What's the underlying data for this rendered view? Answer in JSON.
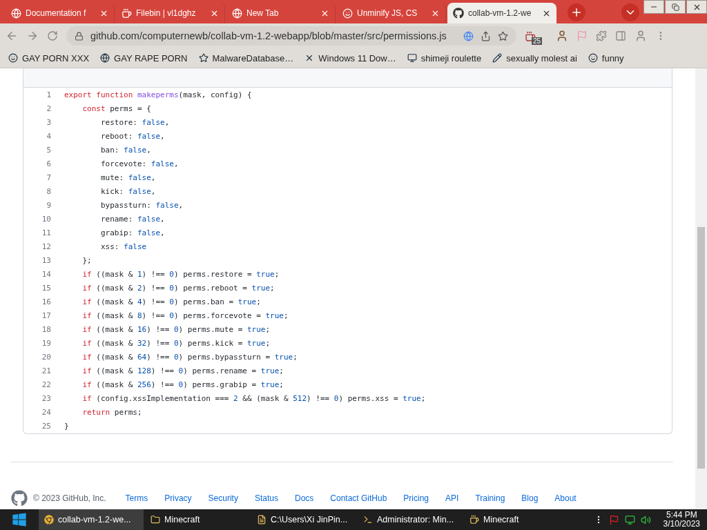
{
  "browser": {
    "tabs": [
      {
        "title": "Documentation f",
        "selected": false
      },
      {
        "title": "Filebin | vl1dghz",
        "selected": false
      },
      {
        "title": "New Tab",
        "selected": false
      },
      {
        "title": "Unminify JS, CS",
        "selected": false
      },
      {
        "title": "collab-vm-1.2-we",
        "selected": true
      }
    ],
    "address": "github.com/computernewb/collab-vm-1.2-webapp/blob/master/src/permissions.js",
    "extension_badge": "25",
    "bookmarks": [
      {
        "label": "GAY PORN XXX"
      },
      {
        "label": "GAY RAPE PORN"
      },
      {
        "label": "MalwareDatabase…"
      },
      {
        "label": "Windows 11 Dow…"
      },
      {
        "label": "shimeji roulette"
      },
      {
        "label": "sexually molest ai"
      },
      {
        "label": "funny"
      }
    ]
  },
  "code": {
    "lines": [
      {
        "number": "1",
        "tokens": [
          {
            "kind": "keyword",
            "text": "export function"
          },
          {
            "kind": "entity",
            "text": " makeperms"
          },
          {
            "kind": "plain",
            "text": "(mask, config) {"
          }
        ]
      },
      {
        "number": "2",
        "tokens": [
          {
            "kind": "keyword",
            "text": "    const"
          },
          {
            "kind": "plain",
            "text": " perms = {"
          }
        ]
      },
      {
        "number": "3",
        "tokens": [
          {
            "kind": "plain",
            "text": "        restore: "
          },
          {
            "kind": "constant",
            "text": "false"
          },
          {
            "kind": "plain",
            "text": ","
          }
        ]
      },
      {
        "number": "4",
        "tokens": [
          {
            "kind": "plain",
            "text": "        reboot: "
          },
          {
            "kind": "constant",
            "text": "false"
          },
          {
            "kind": "plain",
            "text": ","
          }
        ]
      },
      {
        "number": "5",
        "tokens": [
          {
            "kind": "plain",
            "text": "        ban: "
          },
          {
            "kind": "constant",
            "text": "false"
          },
          {
            "kind": "plain",
            "text": ","
          }
        ]
      },
      {
        "number": "6",
        "tokens": [
          {
            "kind": "plain",
            "text": "        forcevote: "
          },
          {
            "kind": "constant",
            "text": "false"
          },
          {
            "kind": "plain",
            "text": ","
          }
        ]
      },
      {
        "number": "7",
        "tokens": [
          {
            "kind": "plain",
            "text": "        mute: "
          },
          {
            "kind": "constant",
            "text": "false"
          },
          {
            "kind": "plain",
            "text": ","
          }
        ]
      },
      {
        "number": "8",
        "tokens": [
          {
            "kind": "plain",
            "text": "        kick: "
          },
          {
            "kind": "constant",
            "text": "false"
          },
          {
            "kind": "plain",
            "text": ","
          }
        ]
      },
      {
        "number": "9",
        "tokens": [
          {
            "kind": "plain",
            "text": "        bypassturn: "
          },
          {
            "kind": "constant",
            "text": "false"
          },
          {
            "kind": "plain",
            "text": ","
          }
        ]
      },
      {
        "number": "10",
        "tokens": [
          {
            "kind": "plain",
            "text": "        rename: "
          },
          {
            "kind": "constant",
            "text": "false"
          },
          {
            "kind": "plain",
            "text": ","
          }
        ]
      },
      {
        "number": "11",
        "tokens": [
          {
            "kind": "plain",
            "text": "        grabip: "
          },
          {
            "kind": "constant",
            "text": "false"
          },
          {
            "kind": "plain",
            "text": ","
          }
        ]
      },
      {
        "number": "12",
        "tokens": [
          {
            "kind": "plain",
            "text": "        xss: "
          },
          {
            "kind": "constant",
            "text": "false"
          }
        ]
      },
      {
        "number": "13",
        "tokens": [
          {
            "kind": "plain",
            "text": "    };"
          }
        ]
      },
      {
        "number": "14",
        "tokens": [
          {
            "kind": "keyword",
            "text": "    if"
          },
          {
            "kind": "plain",
            "text": " ((mask & "
          },
          {
            "kind": "constant",
            "text": "1"
          },
          {
            "kind": "plain",
            "text": ") !== "
          },
          {
            "kind": "constant",
            "text": "0"
          },
          {
            "kind": "plain",
            "text": ") perms.restore = "
          },
          {
            "kind": "constant",
            "text": "true"
          },
          {
            "kind": "plain",
            "text": ";"
          }
        ]
      },
      {
        "number": "15",
        "tokens": [
          {
            "kind": "keyword",
            "text": "    if"
          },
          {
            "kind": "plain",
            "text": " ((mask & "
          },
          {
            "kind": "constant",
            "text": "2"
          },
          {
            "kind": "plain",
            "text": ") !== "
          },
          {
            "kind": "constant",
            "text": "0"
          },
          {
            "kind": "plain",
            "text": ") perms.reboot = "
          },
          {
            "kind": "constant",
            "text": "true"
          },
          {
            "kind": "plain",
            "text": ";"
          }
        ]
      },
      {
        "number": "16",
        "tokens": [
          {
            "kind": "keyword",
            "text": "    if"
          },
          {
            "kind": "plain",
            "text": " ((mask & "
          },
          {
            "kind": "constant",
            "text": "4"
          },
          {
            "kind": "plain",
            "text": ") !== "
          },
          {
            "kind": "constant",
            "text": "0"
          },
          {
            "kind": "plain",
            "text": ") perms.ban = "
          },
          {
            "kind": "constant",
            "text": "true"
          },
          {
            "kind": "plain",
            "text": ";"
          }
        ]
      },
      {
        "number": "17",
        "tokens": [
          {
            "kind": "keyword",
            "text": "    if"
          },
          {
            "kind": "plain",
            "text": " ((mask & "
          },
          {
            "kind": "constant",
            "text": "8"
          },
          {
            "kind": "plain",
            "text": ") !== "
          },
          {
            "kind": "constant",
            "text": "0"
          },
          {
            "kind": "plain",
            "text": ") perms.forcevote = "
          },
          {
            "kind": "constant",
            "text": "true"
          },
          {
            "kind": "plain",
            "text": ";"
          }
        ]
      },
      {
        "number": "18",
        "tokens": [
          {
            "kind": "keyword",
            "text": "    if"
          },
          {
            "kind": "plain",
            "text": " ((mask & "
          },
          {
            "kind": "constant",
            "text": "16"
          },
          {
            "kind": "plain",
            "text": ") !== "
          },
          {
            "kind": "constant",
            "text": "0"
          },
          {
            "kind": "plain",
            "text": ") perms.mute = "
          },
          {
            "kind": "constant",
            "text": "true"
          },
          {
            "kind": "plain",
            "text": ";"
          }
        ]
      },
      {
        "number": "19",
        "tokens": [
          {
            "kind": "keyword",
            "text": "    if"
          },
          {
            "kind": "plain",
            "text": " ((mask & "
          },
          {
            "kind": "constant",
            "text": "32"
          },
          {
            "kind": "plain",
            "text": ") !== "
          },
          {
            "kind": "constant",
            "text": "0"
          },
          {
            "kind": "plain",
            "text": ") perms.kick = "
          },
          {
            "kind": "constant",
            "text": "true"
          },
          {
            "kind": "plain",
            "text": ";"
          }
        ]
      },
      {
        "number": "20",
        "tokens": [
          {
            "kind": "keyword",
            "text": "    if"
          },
          {
            "kind": "plain",
            "text": " ((mask & "
          },
          {
            "kind": "constant",
            "text": "64"
          },
          {
            "kind": "plain",
            "text": ") !== "
          },
          {
            "kind": "constant",
            "text": "0"
          },
          {
            "kind": "plain",
            "text": ") perms.bypassturn = "
          },
          {
            "kind": "constant",
            "text": "true"
          },
          {
            "kind": "plain",
            "text": ";"
          }
        ]
      },
      {
        "number": "21",
        "tokens": [
          {
            "kind": "keyword",
            "text": "    if"
          },
          {
            "kind": "plain",
            "text": " ((mask & "
          },
          {
            "kind": "constant",
            "text": "128"
          },
          {
            "kind": "plain",
            "text": ") !== "
          },
          {
            "kind": "constant",
            "text": "0"
          },
          {
            "kind": "plain",
            "text": ") perms.rename = "
          },
          {
            "kind": "constant",
            "text": "true"
          },
          {
            "kind": "plain",
            "text": ";"
          }
        ]
      },
      {
        "number": "22",
        "tokens": [
          {
            "kind": "keyword",
            "text": "    if"
          },
          {
            "kind": "plain",
            "text": " ((mask & "
          },
          {
            "kind": "constant",
            "text": "256"
          },
          {
            "kind": "plain",
            "text": ") !== "
          },
          {
            "kind": "constant",
            "text": "0"
          },
          {
            "kind": "plain",
            "text": ") perms.grabip = "
          },
          {
            "kind": "constant",
            "text": "true"
          },
          {
            "kind": "plain",
            "text": ";"
          }
        ]
      },
      {
        "number": "23",
        "tokens": [
          {
            "kind": "keyword",
            "text": "    if"
          },
          {
            "kind": "plain",
            "text": " (config.xssImplementation === "
          },
          {
            "kind": "constant",
            "text": "2"
          },
          {
            "kind": "plain",
            "text": " && (mask & "
          },
          {
            "kind": "constant",
            "text": "512"
          },
          {
            "kind": "plain",
            "text": ") !== "
          },
          {
            "kind": "constant",
            "text": "0"
          },
          {
            "kind": "plain",
            "text": ") perms.xss = "
          },
          {
            "kind": "constant",
            "text": "true"
          },
          {
            "kind": "plain",
            "text": ";"
          }
        ]
      },
      {
        "number": "24",
        "tokens": [
          {
            "kind": "keyword",
            "text": "    return"
          },
          {
            "kind": "plain",
            "text": " perms;"
          }
        ]
      },
      {
        "number": "25",
        "tokens": [
          {
            "kind": "plain",
            "text": "}"
          }
        ]
      }
    ]
  },
  "footer": {
    "copyright": "© 2023 GitHub, Inc.",
    "links": [
      "Terms",
      "Privacy",
      "Security",
      "Status",
      "Docs",
      "Contact GitHub",
      "Pricing",
      "API",
      "Training",
      "Blog",
      "About"
    ]
  },
  "taskbar": {
    "items": [
      {
        "label": "collab-vm-1.2-we...",
        "selected": true
      },
      {
        "label": "Minecraft",
        "selected": false
      },
      {
        "label": "C:\\Users\\Xi JinPin...",
        "selected": false
      },
      {
        "label": "Administrator:  Min...",
        "selected": false
      },
      {
        "label": "Minecraft",
        "selected": false
      }
    ],
    "time": "5:44 PM",
    "date": "3/10/2023"
  }
}
